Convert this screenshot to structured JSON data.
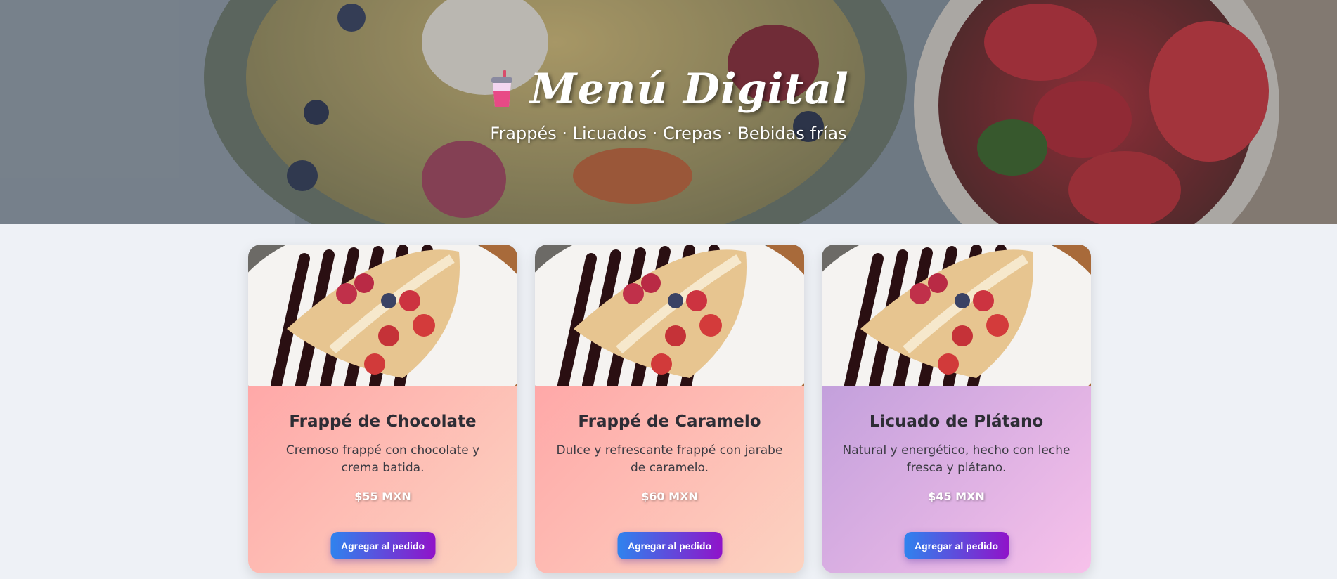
{
  "header": {
    "title": "Menú Digital",
    "subtitle": "Frappés · Licuados · Crepas · Bebidas frías"
  },
  "products": [
    {
      "name": "Frappé de Chocolate",
      "description": "Cremoso frappé con chocolate y crema batida.",
      "price": "$55 MXN",
      "button": "Agregar al pedido"
    },
    {
      "name": "Frappé de Caramelo",
      "description": "Dulce y refrescante frappé con jarabe de caramelo.",
      "price": "$60 MXN",
      "button": "Agregar al pedido"
    },
    {
      "name": "Licuado de Plátano",
      "description": "Natural y energético, hecho con leche fresca y plátano.",
      "price": "$45 MXN",
      "button": "Agregar al pedido"
    }
  ],
  "colors": {
    "card_peach_start": "#ffa8a8",
    "card_peach_end": "#fcd3c1",
    "card_lilac_start": "#c3a0dc",
    "card_lilac_end": "#f7c1ea",
    "button_start": "#2f83ee",
    "button_end": "#9013c9",
    "page_background": "#eef1f6"
  },
  "icons": {
    "title_icon": "cup-with-straw-icon"
  }
}
